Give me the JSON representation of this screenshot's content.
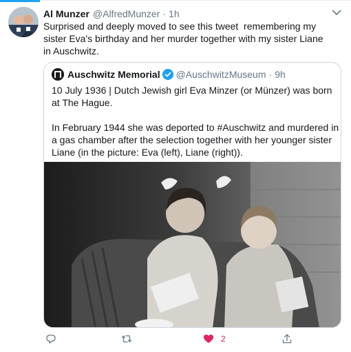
{
  "tweet": {
    "author_name": "Al Munzer",
    "author_handle": "@AlfredMunzer",
    "separator": "·",
    "time": "1h",
    "text": "Surprised and deeply moved to see this tweet  remembering my sister Eva's birthday and her murder together with my sister Liane in Auschwitz."
  },
  "quoted": {
    "author_name": "Auschwitz Memorial",
    "author_handle": "@AuschwitzMuseum",
    "separator": "·",
    "time": "9h",
    "text": "10 July 1936 | Dutch Jewish girl Eva Minzer (or Münzer) was born at The Hague.\n\nIn February 1944 she was deported to #Auschwitz and murdered in a gas chamber after the selection together with her younger sister Liane (in the picture: Eva (left), Liane (right)).",
    "image_icon": "black-and-white-photo-two-girls"
  },
  "actions": {
    "reply_icon": "reply-icon",
    "retweet_icon": "retweet-icon",
    "like_icon": "heart-filled-icon",
    "like_count": "2",
    "share_icon": "share-icon"
  },
  "colors": {
    "accent": "#1da1f2",
    "secondary_text": "#657786",
    "like": "#e0245e",
    "border": "#ccd6dd"
  }
}
